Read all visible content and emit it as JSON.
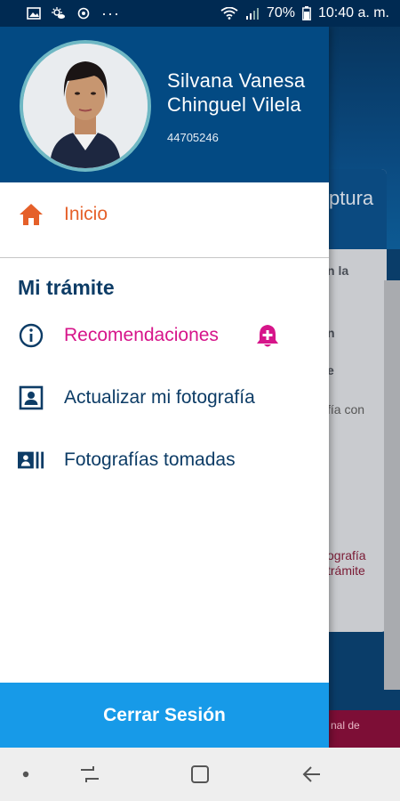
{
  "status_bar": {
    "dots": "···",
    "battery": "70%",
    "time": "10:40 a. m."
  },
  "user": {
    "name_line1": "Silvana Vanesa",
    "name_line2": "Chinguel Vilela",
    "id": "44705246"
  },
  "menu": {
    "home_label": "Inicio",
    "section_title": "Mi trámite",
    "items": [
      {
        "label": "Recomendaciones",
        "icon": "info-icon"
      },
      {
        "label": "Actualizar mi fotografía",
        "icon": "portrait-icon"
      },
      {
        "label": "Fotografías tomadas",
        "icon": "gallery-icon"
      }
    ],
    "logout_label": "Cerrar Sesión"
  },
  "background": {
    "card_title": "ptura",
    "line1": "n la",
    "line2": "n",
    "line3": "e",
    "line4": "fía con",
    "line5": "ografía",
    "line6": "trámite",
    "footer": "nal de"
  },
  "colors": {
    "header_blue": "#034a83",
    "accent_orange": "#e5602a",
    "accent_magenta": "#d6158a",
    "logout_blue": "#179ae8",
    "text_navy": "#0d3c66"
  }
}
